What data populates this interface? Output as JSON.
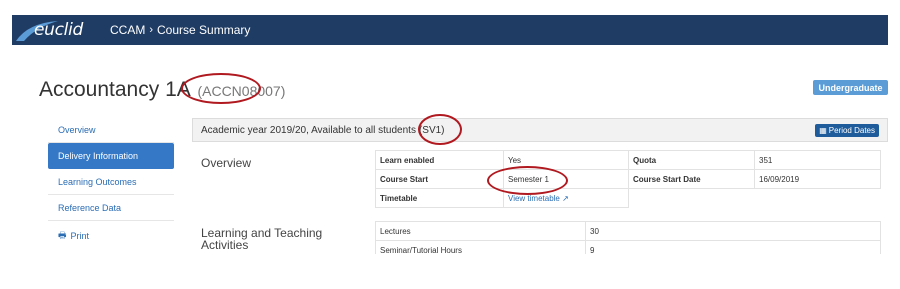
{
  "header": {
    "logo_text": "euclid",
    "crumbs": [
      "CCAM",
      "Course Summary"
    ],
    "sep": "›"
  },
  "course": {
    "title": "Accountancy 1A",
    "code": "(ACCN08007)",
    "level_badge": "Undergraduate"
  },
  "sidebar": {
    "items": [
      {
        "label": "Overview",
        "active": false
      },
      {
        "label": "Delivery Information",
        "active": true
      },
      {
        "label": "Learning Outcomes",
        "active": false
      },
      {
        "label": "Reference Data",
        "active": false
      }
    ],
    "print_label": "Print"
  },
  "panel": {
    "heading_prefix": "Academic year 2019/20, Available to all students",
    "heading_code": "(SV1)",
    "period_button": "Period Dates"
  },
  "overview": {
    "title": "Overview",
    "rows": [
      {
        "l1": "Learn enabled",
        "v1": "Yes",
        "l2": "Quota",
        "v2": "351"
      },
      {
        "l1": "Course Start",
        "v1": "Semester 1",
        "l2": "Course Start Date",
        "v2": "16/09/2019"
      },
      {
        "l1": "Timetable",
        "v1": "View timetable"
      }
    ]
  },
  "activities": {
    "title": "Learning and Teaching Activities",
    "rows": [
      {
        "label": "Lectures",
        "value": "30"
      },
      {
        "label": "Seminar/Tutorial Hours",
        "value": "9"
      }
    ]
  },
  "colors": {
    "header_bg": "#1f3c64",
    "accent": "#3478c6",
    "badge": "#5b9bd6",
    "annotation": "#b0191f"
  }
}
